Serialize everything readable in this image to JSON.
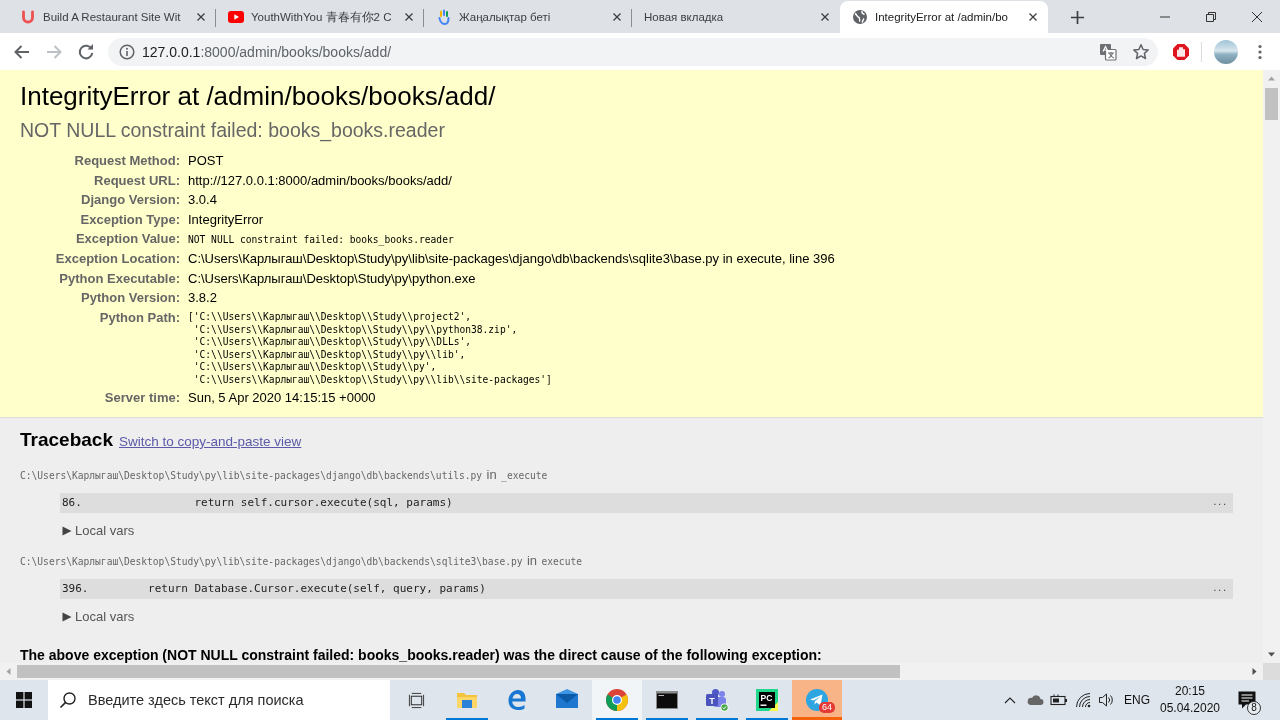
{
  "browser": {
    "tabs": [
      {
        "title": "Build A Restaurant Site Wit",
        "selected": false
      },
      {
        "title": "YouthWithYou 青春有你2 C",
        "selected": false
      },
      {
        "title": "Жаңалықтар беті",
        "selected": false
      },
      {
        "title": "Новая вкладка",
        "selected": false
      },
      {
        "title": "IntegrityError at /admin/bo",
        "selected": true
      }
    ],
    "nav": {
      "back_disabled": false,
      "forward_disabled": true
    },
    "address": {
      "host": "127.0.0.1",
      "path": ":8000/admin/books/books/add/"
    }
  },
  "summary": {
    "title": "IntegrityError at /admin/books/books/add/",
    "subtitle": "NOT NULL constraint failed: books_books.reader",
    "meta": [
      {
        "label": "Request Method:",
        "kind": "text",
        "value": "POST"
      },
      {
        "label": "Request URL:",
        "kind": "text",
        "value": "http://127.0.0.1:8000/admin/books/books/add/"
      },
      {
        "label": "Django Version:",
        "kind": "text",
        "value": "3.0.4"
      },
      {
        "label": "Exception Type:",
        "kind": "text",
        "value": "IntegrityError"
      },
      {
        "label": "Exception Value:",
        "kind": "code",
        "value": "NOT NULL constraint failed: books_books.reader"
      },
      {
        "label": "Exception Location:",
        "kind": "text",
        "value": "C:\\Users\\Карлыгаш\\Desktop\\Study\\py\\lib\\site-packages\\django\\db\\backends\\sqlite3\\base.py in execute, line 396"
      },
      {
        "label": "Python Executable:",
        "kind": "text",
        "value": "C:\\Users\\Карлыгаш\\Desktop\\Study\\py\\python.exe"
      },
      {
        "label": "Python Version:",
        "kind": "text",
        "value": "3.8.2"
      },
      {
        "label": "Python Path:",
        "kind": "lines",
        "lines": [
          "['C:\\\\Users\\\\Карлыгаш\\\\Desktop\\\\Study\\\\project2',",
          " 'C:\\\\Users\\\\Карлыгаш\\\\Desktop\\\\Study\\\\py\\\\python38.zip',",
          " 'C:\\\\Users\\\\Карлыгаш\\\\Desktop\\\\Study\\\\py\\\\DLLs',",
          " 'C:\\\\Users\\\\Карлыгаш\\\\Desktop\\\\Study\\\\py\\\\lib',",
          " 'C:\\\\Users\\\\Карлыгаш\\\\Desktop\\\\Study\\\\py',",
          " 'C:\\\\Users\\\\Карлыгаш\\\\Desktop\\\\Study\\\\py\\\\lib\\\\site-packages']"
        ]
      },
      {
        "label": "Server time:",
        "kind": "text",
        "value": "Sun, 5 Apr 2020 14:15:15 +0000"
      }
    ]
  },
  "traceback": {
    "title": "Traceback",
    "link": "Switch to copy-and-paste view",
    "frames": [
      {
        "file": "C:\\Users\\Карлыгаш\\Desktop\\Study\\py\\lib\\site-packages\\django\\db\\backends\\utils.py",
        "in_text": "in",
        "function": "_execute",
        "line_no": "86.",
        "code": "                return self.cursor.execute(sql, params)",
        "context_marker": "...",
        "vars_label": "Local vars",
        "expanded": false
      },
      {
        "file": "C:\\Users\\Карлыгаш\\Desktop\\Study\\py\\lib\\site-packages\\django\\db\\backends\\sqlite3\\base.py",
        "in_text": "in",
        "function": "execute",
        "line_no": "396.",
        "code": "        return Database.Cursor.execute(self, query, params)",
        "context_marker": "...",
        "vars_label": "Local vars",
        "expanded": false
      }
    ],
    "cause": "The above exception (NOT NULL constraint failed: books_books.reader) was the direct cause of the following exception:"
  },
  "taskbar": {
    "search": {
      "placeholder": "Введите здесь текст для поиска"
    },
    "apps": [
      {
        "running": true,
        "selected": false,
        "attention": false
      },
      {
        "running": false,
        "selected": false,
        "attention": false
      },
      {
        "running": false,
        "selected": false,
        "attention": false
      },
      {
        "running": true,
        "selected": true,
        "attention": false
      },
      {
        "running": true,
        "selected": false,
        "attention": false
      },
      {
        "running": true,
        "selected": false,
        "attention": false,
        "label": "T"
      },
      {
        "running": true,
        "selected": false,
        "attention": false,
        "label": "PC"
      },
      {
        "running": true,
        "selected": false,
        "attention": true,
        "badge": "64"
      }
    ],
    "tray": {
      "language": "ENG",
      "time": "20:15",
      "date": "05.04.2020",
      "notifications": "8"
    }
  }
}
